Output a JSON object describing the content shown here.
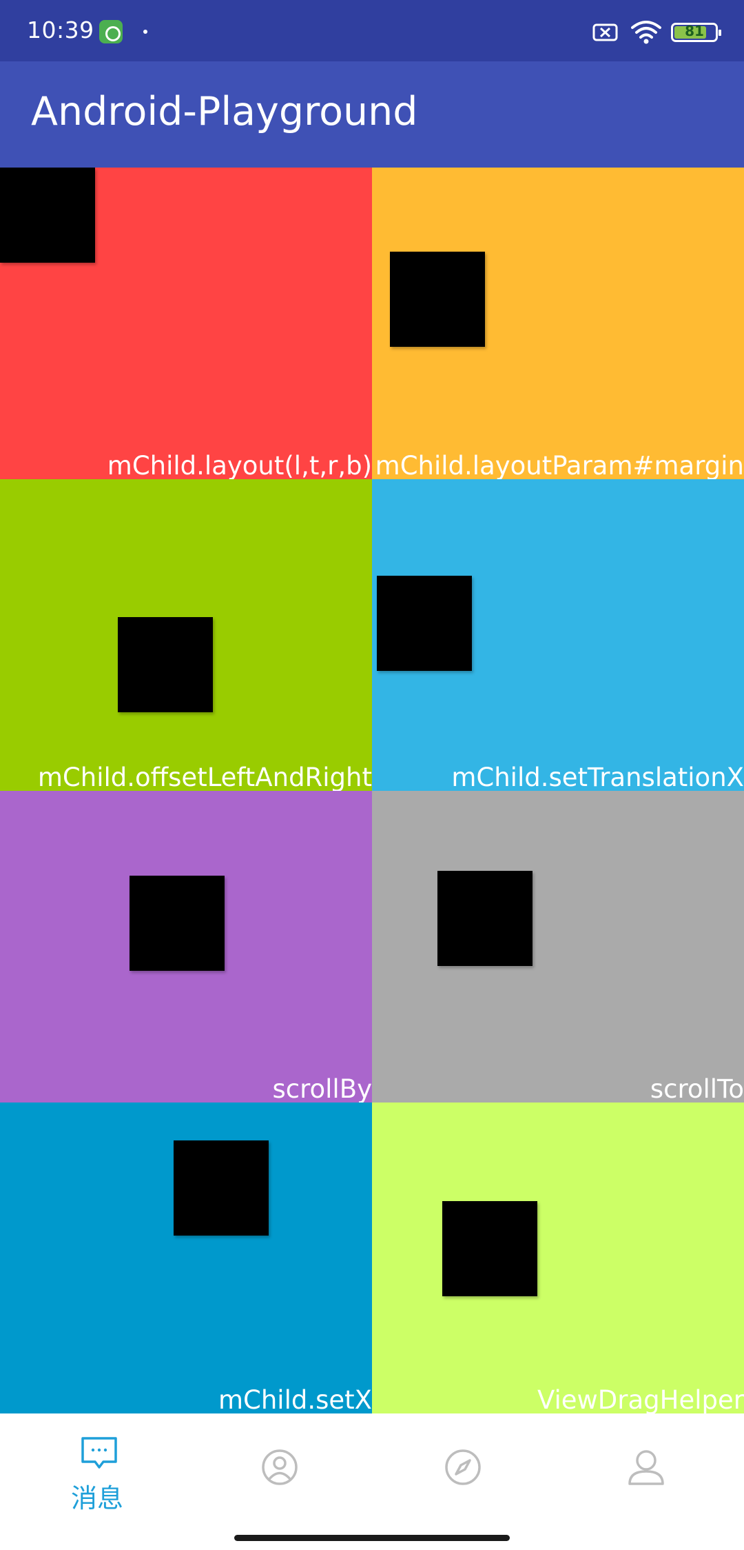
{
  "status_bar": {
    "time": "10:39",
    "battery": "81",
    "battery_level": 0.81,
    "icons": [
      "notification-app-icon",
      "sim-off-icon",
      "wifi-icon",
      "battery-icon"
    ]
  },
  "app_bar": {
    "title": "Android-Playground"
  },
  "cells": [
    {
      "label": "mChild.layout(l,t,r,b)",
      "color": "#FF4444"
    },
    {
      "label": "mChild.layoutParam#margin",
      "color": "#FFBB33"
    },
    {
      "label": "mChild.offsetLeftAndRight",
      "color": "#99CC00"
    },
    {
      "label": "mChild.setTranslationX",
      "color": "#33B5E5"
    },
    {
      "label": "scrollBy",
      "color": "#AA66CC"
    },
    {
      "label": "scrollTo",
      "color": "#AAAAAA"
    },
    {
      "label": "mChild.setX",
      "color": "#0099CC"
    },
    {
      "label": "ViewDragHelper",
      "color": "#CCFF66"
    }
  ],
  "bottom_nav": {
    "items": [
      {
        "label": "消息",
        "icon": "chat-icon",
        "active": true
      },
      {
        "label": "",
        "icon": "contact-icon",
        "active": false
      },
      {
        "label": "",
        "icon": "compass-icon",
        "active": false
      },
      {
        "label": "",
        "icon": "person-icon",
        "active": false
      }
    ],
    "active_color": "#1E9FD9",
    "inactive_color": "#BDBDBD"
  }
}
